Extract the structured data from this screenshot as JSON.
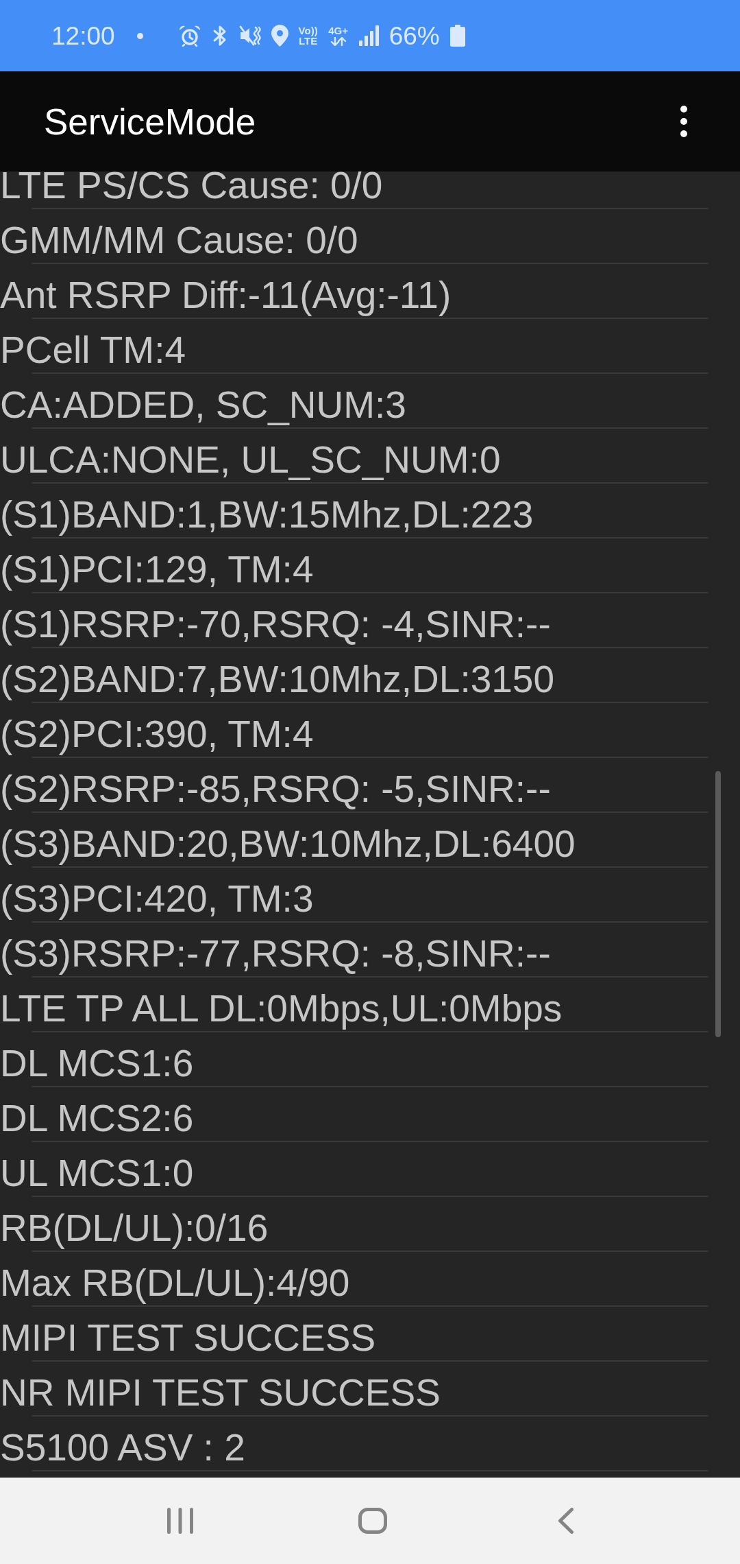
{
  "status_bar": {
    "time": "12:00",
    "volte": [
      "Vo))",
      "LTE"
    ],
    "network": "4G+",
    "battery": "66%"
  },
  "app_bar": {
    "title": "ServiceMode"
  },
  "rows": [
    "LTE PS/CS Cause: 0/0",
    "GMM/MM Cause: 0/0",
    "Ant RSRP Diff:-11(Avg:-11)",
    "PCell TM:4",
    "CA:ADDED, SC_NUM:3",
    "ULCA:NONE, UL_SC_NUM:0",
    "(S1)BAND:1,BW:15Mhz,DL:223",
    "(S1)PCI:129, TM:4",
    "(S1)RSRP:-70,RSRQ: -4,SINR:--",
    "(S2)BAND:7,BW:10Mhz,DL:3150",
    "(S2)PCI:390, TM:4",
    "(S2)RSRP:-85,RSRQ: -5,SINR:--",
    "(S3)BAND:20,BW:10Mhz,DL:6400",
    "(S3)PCI:420, TM:3",
    "(S3)RSRP:-77,RSRQ: -8,SINR:--",
    "LTE TP ALL DL:0Mbps,UL:0Mbps",
    "DL MCS1:6",
    "DL MCS2:6",
    "UL MCS1:0",
    "RB(DL/UL):0/16",
    "Max RB(DL/UL):4/90",
    "MIPI TEST SUCCESS",
    "NR MIPI TEST SUCCESS",
    "S5100 ASV : 2"
  ]
}
